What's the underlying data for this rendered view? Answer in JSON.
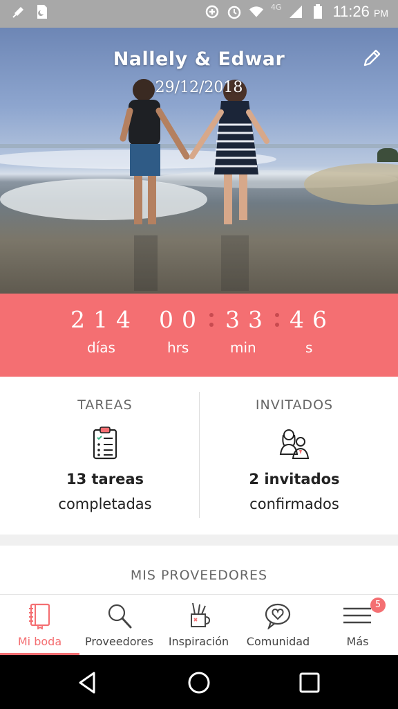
{
  "status_bar": {
    "time": "11:26",
    "ampm": "PM",
    "network": "4G",
    "icons": [
      "mic-off-icon",
      "sim-icon",
      "data-saver-icon",
      "alarm-icon",
      "wifi-icon",
      "signal-icon",
      "battery-icon"
    ]
  },
  "hero": {
    "title": "Nallely & Edwar",
    "date": "29/12/2018",
    "edit_icon": "pencil-icon"
  },
  "countdown": {
    "days": "214",
    "hours": "00",
    "minutes": "33",
    "seconds": "46",
    "days_label": "días",
    "hours_label": "hrs",
    "minutes_label": "min",
    "seconds_label": "s"
  },
  "stats": {
    "tasks": {
      "title": "TAREAS",
      "count": "13 tareas",
      "sub": "completadas",
      "icon": "clipboard-checklist-icon"
    },
    "guests": {
      "title": "INVITADOS",
      "count": "2 invitados",
      "sub": "confirmados",
      "icon": "guests-icon"
    }
  },
  "providers": {
    "title": "MIS PROVEEDORES"
  },
  "bottom_nav": {
    "items": [
      {
        "label": "Mi boda",
        "icon": "notebook-icon",
        "active": true
      },
      {
        "label": "Proveedores",
        "icon": "search-icon",
        "active": false
      },
      {
        "label": "Inspiración",
        "icon": "pencil-cup-icon",
        "active": false
      },
      {
        "label": "Comunidad",
        "icon": "heart-chat-icon",
        "active": false
      },
      {
        "label": "Más",
        "icon": "menu-icon",
        "active": false,
        "badge": "5"
      }
    ]
  },
  "colors": {
    "accent": "#f46f72",
    "status_bar": "#a8a8a8"
  }
}
